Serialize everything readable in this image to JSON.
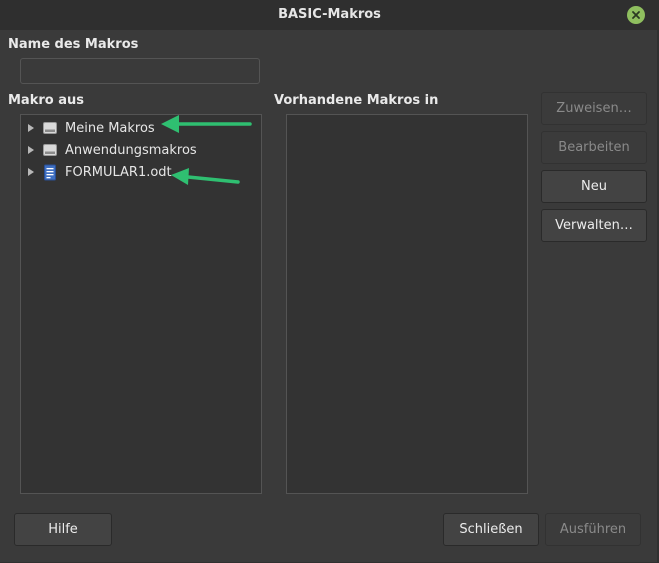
{
  "window": {
    "title": "BASIC-Makros"
  },
  "name_section": {
    "label": "Name des Makros",
    "value": ""
  },
  "left_panel": {
    "label": "Makro aus",
    "items": [
      {
        "label": "Meine Makros",
        "icon": "drive-icon"
      },
      {
        "label": "Anwendungsmakros",
        "icon": "drive-icon"
      },
      {
        "label": "FORMULAR1.odt",
        "icon": "document-icon"
      }
    ]
  },
  "right_panel": {
    "label": "Vorhandene Makros in"
  },
  "side_buttons": {
    "zuweisen": "Zuweisen…",
    "bearbeiten": "Bearbeiten",
    "neu": "Neu",
    "verwalten": "Verwalten…"
  },
  "footer": {
    "hilfe": "Hilfe",
    "schliessen": "Schließen",
    "ausfuehren": "Ausführen"
  },
  "colors": {
    "background": "#3a3a3a",
    "close_button": "#8fbf5f",
    "annotation_arrow": "#2fbf71"
  }
}
